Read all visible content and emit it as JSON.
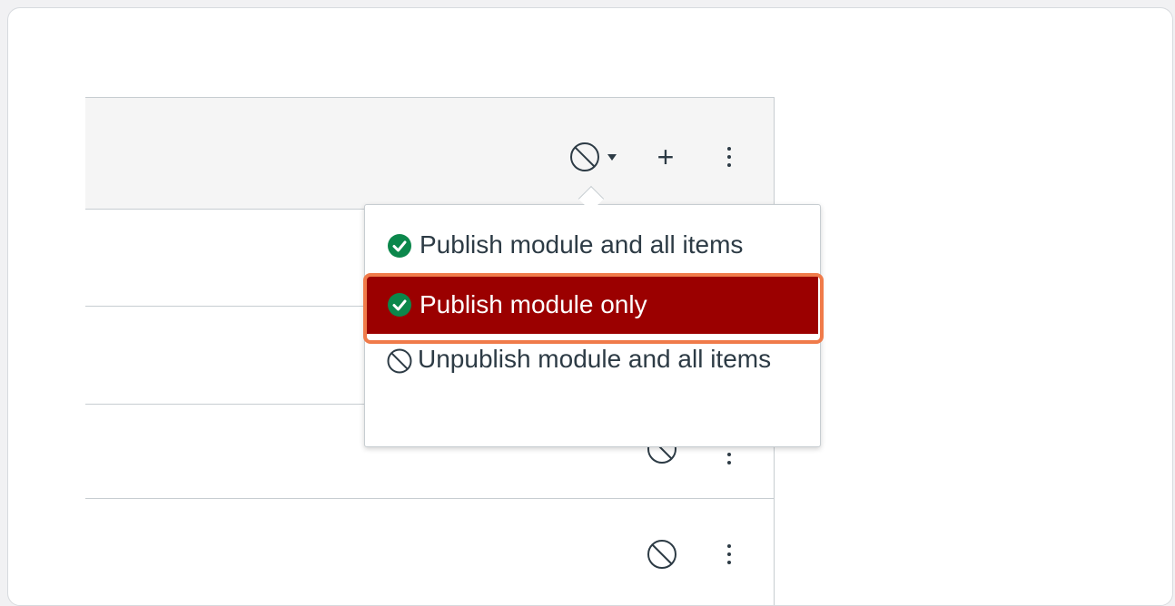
{
  "menu": {
    "items": [
      {
        "label": "Publish module and all items",
        "icon": "published-check-icon"
      },
      {
        "label": "Publish module only",
        "icon": "published-check-icon",
        "selected": true
      },
      {
        "label": "Unpublish module and all items",
        "icon": "unpublished-ban-icon"
      }
    ]
  },
  "header": {
    "publish_status_icon": "unpublished-ban-icon",
    "add_icon": "plus-icon",
    "options_icon": "kebab-icon"
  },
  "rows": [
    {
      "status_icon": "unpublished-ban-icon",
      "options_icon": "kebab-icon"
    },
    {
      "status_icon": "unpublished-ban-icon",
      "options_icon": "kebab-icon"
    }
  ],
  "colors": {
    "selected_bg": "#9b0000",
    "published_green": "#0b874b",
    "highlight_outline": "#f07b4a",
    "text": "#2d3b45"
  }
}
